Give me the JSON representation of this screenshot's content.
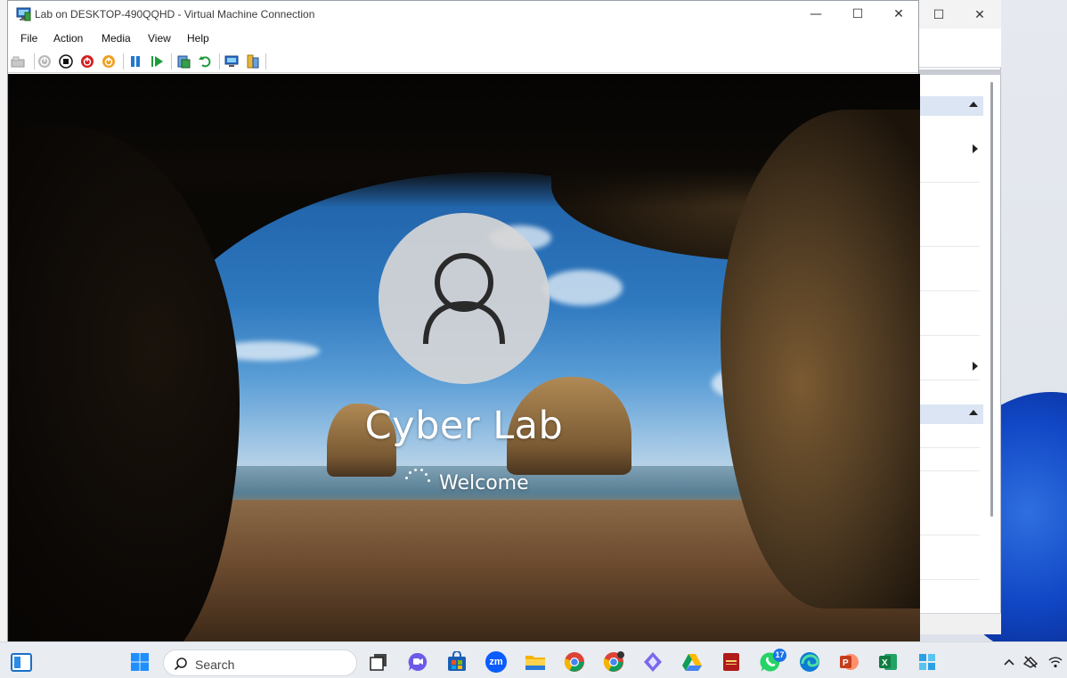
{
  "window": {
    "title": "Lab on DESKTOP-490QQHD - Virtual Machine Connection",
    "minimize_glyph": "—",
    "maximize_glyph": "☐",
    "close_glyph": "✕"
  },
  "menu": {
    "items": [
      "File",
      "Action",
      "Media",
      "View",
      "Help"
    ]
  },
  "toolbar": {
    "buttons": [
      {
        "icon": "ctrl-alt-del-icon"
      },
      {
        "icon": "start-icon"
      },
      {
        "icon": "turn-off-icon"
      },
      {
        "icon": "shut-down-icon"
      },
      {
        "icon": "power-icon"
      },
      {
        "icon": "pause-icon"
      },
      {
        "icon": "resume-icon"
      },
      {
        "icon": "checkpoint-icon"
      },
      {
        "icon": "revert-icon"
      },
      {
        "icon": "enhanced-session-icon"
      },
      {
        "icon": "share-icon"
      }
    ]
  },
  "vm_screen": {
    "user_name": "Cyber Lab",
    "status": "Welcome"
  },
  "background_window": {
    "minimize_glyph": "☐",
    "close_glyph": "✕"
  },
  "taskbar": {
    "search_placeholder": "Search",
    "whatsapp_badge": "17",
    "zoom_label": "zm",
    "apps": [
      "start",
      "search",
      "task-view",
      "teams-chat",
      "microsoft-store",
      "zoom",
      "file-explorer",
      "chrome",
      "chrome-profile",
      "copilot",
      "google-drive",
      "holy-bible",
      "whatsapp",
      "edge",
      "powerpoint",
      "excel",
      "azure-data"
    ]
  },
  "colors": {
    "accent": "#0067c0",
    "taskbar": "#e9ecf1",
    "titlebar": "#ffffff"
  }
}
